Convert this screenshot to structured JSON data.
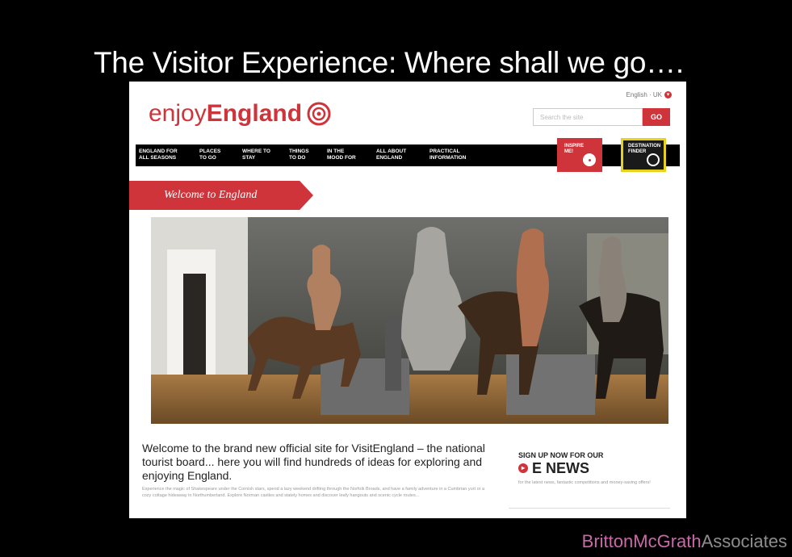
{
  "slide": {
    "title": "The Visitor Experience: Where shall we go…."
  },
  "site": {
    "language": "English · UK",
    "logo": {
      "part1": "enjoy",
      "part2": "England"
    },
    "search": {
      "placeholder": "Search the site",
      "button": "GO"
    },
    "nav": [
      "ENGLAND FOR\nALL SEASONS",
      "PLACES\nTO GO",
      "WHERE TO\nSTAY",
      "THINGS\nTO DO",
      "IN THE\nMOOD FOR",
      "ALL ABOUT\nENGLAND",
      "PRACTICAL\nINFORMATION"
    ],
    "badges": {
      "inspire": "INSPIRE\nME!",
      "destination": "DESTINATION\nFINDER"
    },
    "banner": "Welcome to England",
    "intro": {
      "lead": "Welcome to the brand new official site for VisitEngland – the national tourist board... here you will find hundreds of ideas for exploring and enjoying England.",
      "body": "Experience the magic of Shakespeare under the Cornish stars, spend a lazy weekend drifting through the Norfolk Broads, and have a family adventure in a Cumbrian yurt or a cozy cottage hideaway in Northumberland. Explore Norman castles and stately homes and discover leafy hangouts and scenic cycle routes..."
    },
    "enews": {
      "pre": "SIGN UP NOW FOR OUR",
      "main": "E NEWS",
      "desc": "for the latest news, fantastic competitions and money-saving offers!"
    }
  },
  "footer": {
    "brand_part1": "BrittonMcGrath",
    "brand_part2": "Associates"
  },
  "colors": {
    "brand_red": "#d0343b",
    "accent_yellow": "#e7d21b",
    "footer_pink": "#c86aa7"
  }
}
